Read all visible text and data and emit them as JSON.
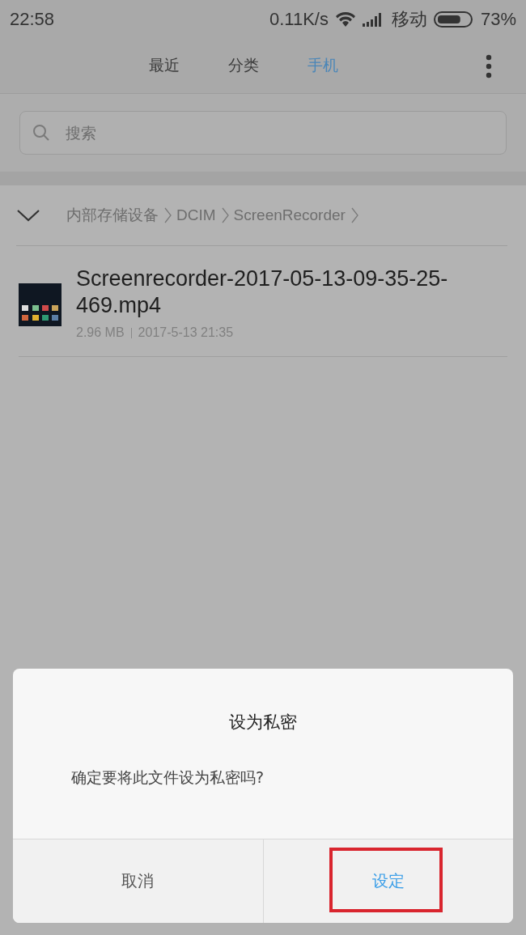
{
  "status_bar": {
    "time": "22:58",
    "speed": "0.11K/s",
    "carrier": "移动",
    "battery": "73%"
  },
  "tabs": [
    {
      "label": "最近",
      "selected": false
    },
    {
      "label": "分类",
      "selected": false
    },
    {
      "label": "手机",
      "selected": true
    }
  ],
  "search": {
    "placeholder": "搜索"
  },
  "breadcrumb": {
    "expanded": true,
    "items": [
      "内部存储设备",
      "DCIM",
      "ScreenRecorder"
    ]
  },
  "files": [
    {
      "name": "Screenrecorder-2017-05-13-09-35-25-469.mp4",
      "size": "2.96 MB",
      "date": "2017-5-13 21:35"
    }
  ],
  "dialog": {
    "title": "设为私密",
    "message": "确定要将此文件设为私密吗?",
    "buttons": [
      {
        "label": "取消",
        "kind": "cancel"
      },
      {
        "label": "设定",
        "kind": "confirm"
      }
    ]
  }
}
